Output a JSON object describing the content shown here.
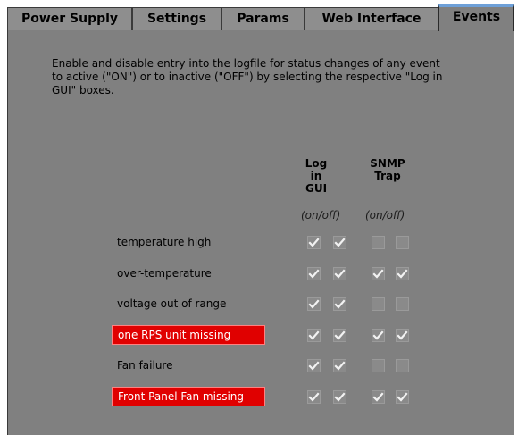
{
  "tabs": [
    {
      "label": "Power Supply",
      "active": false
    },
    {
      "label": "Settings",
      "active": false
    },
    {
      "label": "Params",
      "active": false
    },
    {
      "label": "Web Interface",
      "active": false
    },
    {
      "label": "Events",
      "active": true
    }
  ],
  "description": "Enable and disable entry into the logfile for status changes of any event to active (\"ON\") or to inactive (\"OFF\") by selecting the respective \"Log in GUI\" boxes.",
  "columns": {
    "log_in_gui": [
      "Log",
      "in",
      "GUI"
    ],
    "snmp_trap": [
      "SNMP",
      "Trap"
    ],
    "onoff_log": "(on/off)",
    "onoff_snmp": "(on/off)"
  },
  "colors": {
    "alert": "#e00000",
    "panel": "#808080",
    "active_tab_accent": "#6ea0d8"
  },
  "events": [
    {
      "label": "temperature high",
      "alert": false,
      "log_on": true,
      "log_off": true,
      "snmp_on": false,
      "snmp_off": false
    },
    {
      "label": "over-temperature",
      "alert": false,
      "log_on": true,
      "log_off": true,
      "snmp_on": true,
      "snmp_off": true
    },
    {
      "label": "voltage out of range",
      "alert": false,
      "log_on": true,
      "log_off": true,
      "snmp_on": false,
      "snmp_off": false
    },
    {
      "label": "one RPS unit missing",
      "alert": true,
      "log_on": true,
      "log_off": true,
      "snmp_on": true,
      "snmp_off": true
    },
    {
      "label": "Fan failure",
      "alert": false,
      "log_on": true,
      "log_off": true,
      "snmp_on": false,
      "snmp_off": false
    },
    {
      "label": "Front Panel Fan missing",
      "alert": true,
      "log_on": true,
      "log_off": true,
      "snmp_on": true,
      "snmp_off": true
    }
  ]
}
